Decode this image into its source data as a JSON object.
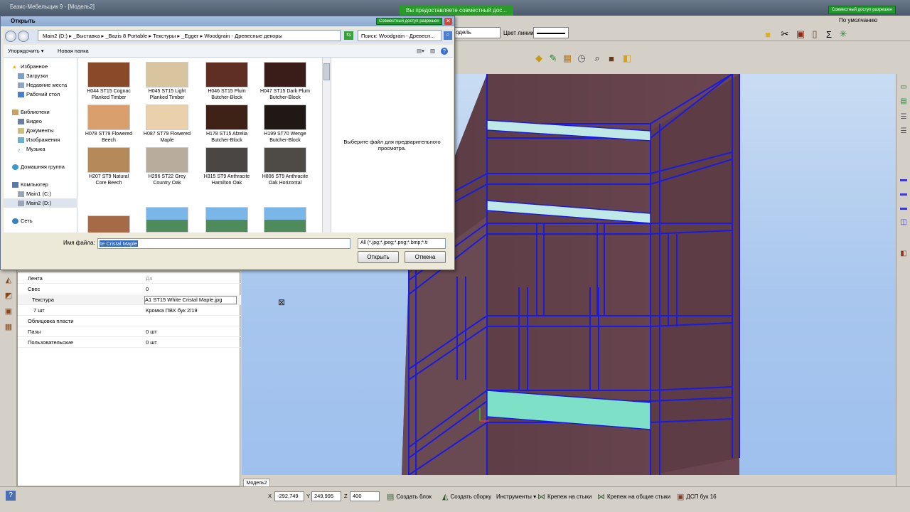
{
  "app": {
    "title": "Базис-Мебельщик 9 - [Модель2]"
  },
  "share": {
    "banner": "Вы предоставляете совместный дос...",
    "small": "Совместный доступ разрешен"
  },
  "topbar": {
    "model_select": "одель",
    "line_color_label": "Цвет линии",
    "default_select": "По умолчанию"
  },
  "dialog": {
    "title": "Открыть",
    "share_badge": "Совместный доступ разрешен",
    "path": [
      "Main2 (D:)",
      "_Выставка",
      "_Bazis 8 Portable",
      "Текстуры",
      "_Egger",
      "Woodgrain - Древесные декоры"
    ],
    "search_placeholder": "Поиск: Woodgrain - Древесн...",
    "organize": "Упорядочить ▾",
    "new_folder": "Новая папка",
    "nav": {
      "favorites": "Избранное",
      "downloads": "Загрузки",
      "recent": "Недавние места",
      "desktop": "Рабочий стол",
      "libraries": "Библиотеки",
      "video": "Видео",
      "documents": "Документы",
      "images": "Изображения",
      "music": "Музыка",
      "homegroup": "Домашняя группа",
      "computer": "Компьютер",
      "main1": "Main1 (C:)",
      "main2": "Main2 (D:)",
      "network": "Сеть"
    },
    "files": [
      {
        "label": "H044 ST15 Cognac Planked Timber",
        "color": "#8a4a2a"
      },
      {
        "label": "H045 ST15 Light Planked Timber",
        "color": "#d9c4a0"
      },
      {
        "label": "H046 ST15 Plum Butcher-Block",
        "color": "#5e2f22"
      },
      {
        "label": "H047 ST15 Dark Plum Butcher-Block",
        "color": "#3a1d18"
      },
      {
        "label": "H078 ST79 Flowered Beech",
        "color": "#d9a06e"
      },
      {
        "label": "H087 ST79 Flowered Maple",
        "color": "#ead1ab"
      },
      {
        "label": "H178 ST15 Afzelia Butcher-Block",
        "color": "#3e2218"
      },
      {
        "label": "H199 ST70 Wenge Butcher-Block",
        "color": "#1f1814"
      },
      {
        "label": "H207 ST9 Natural Core Beech",
        "color": "#b58a58"
      },
      {
        "label": "H296 ST22 Grey Country Oak",
        "color": "#b8ad9c"
      },
      {
        "label": "H315 ST9 Anthracite Hamilton Oak",
        "color": "#4a4644"
      },
      {
        "label": "H806 ST9 Anthracite Oak Horizontal",
        "color": "#4e4a46"
      }
    ],
    "preview_text": "Выберите файл для предварительного просмотра.",
    "filename_label": "Имя файла:",
    "filename_value": "te Cristal Maple",
    "filetype": "All (*.jpg;*.jpeg;*.png;*.bmp;*.ti",
    "open_button": "Открыть",
    "cancel_button": "Отмена"
  },
  "props": [
    {
      "key": "Лента",
      "value": "Да"
    },
    {
      "key": "Свес",
      "value": "0"
    },
    {
      "key": "Текстура",
      "value": "A1 ST15 White Cristal Maple.jpg"
    },
    {
      "key": "7 шт",
      "value": "Кромка ПВХ бук 2/19"
    },
    {
      "key": "Облицовка пласти",
      "value": ""
    },
    {
      "key": "Пазы",
      "value": "0 шт"
    },
    {
      "key": "Пользовательские",
      "value": "0 шт"
    }
  ],
  "model_tab": "Модель2",
  "status": {
    "x_label": "X",
    "x": "-292,749",
    "y_label": "Y",
    "y": "249,995",
    "z_label": "Z",
    "z": "400",
    "create_block": "Создать блок",
    "create_assembly": "Создать сборку",
    "tools": "Инструменты ▾",
    "fasten_ends": "Крепеж на стыки",
    "fasten_common": "Крепеж на общие стыки",
    "material": "ДСП бук 16"
  }
}
